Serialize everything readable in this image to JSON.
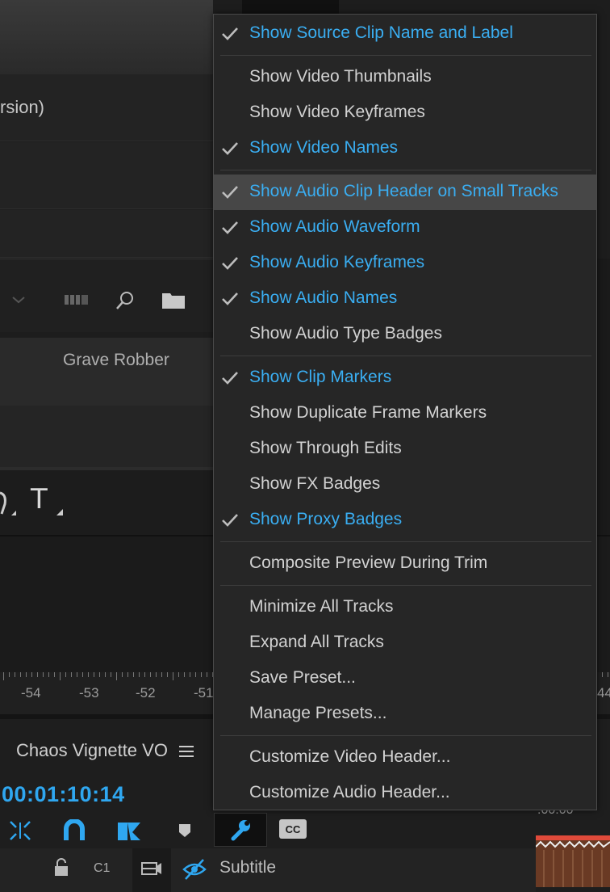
{
  "background": {
    "partial_label": "rsion)",
    "clip_name": "Grave Robber",
    "sequence_title": "Chaos Vignette VO",
    "timecode": "00:01:10:14",
    "ruler_numbers": [
      "-54",
      "-53",
      "-52",
      "-51",
      "44"
    ],
    "track_label": "C1",
    "subtitle_label": "Subtitle",
    "clip_time": ":00:00",
    "text_tool_glyph": "T"
  },
  "menu": {
    "items": [
      {
        "label": "Show Source Clip Name and Label",
        "checked": true
      },
      {
        "label": "Show Video Thumbnails",
        "checked": false
      },
      {
        "label": "Show Video Keyframes",
        "checked": false
      },
      {
        "label": "Show Video Names",
        "checked": true
      },
      {
        "label": "Show Audio Clip Header on Small Tracks",
        "checked": true,
        "highlighted": true
      },
      {
        "label": "Show Audio Waveform",
        "checked": true
      },
      {
        "label": "Show Audio Keyframes",
        "checked": true
      },
      {
        "label": "Show Audio Names",
        "checked": true
      },
      {
        "label": "Show Audio Type Badges",
        "checked": false
      },
      {
        "label": "Show Clip Markers",
        "checked": true
      },
      {
        "label": "Show Duplicate Frame Markers",
        "checked": false
      },
      {
        "label": "Show Through Edits",
        "checked": false
      },
      {
        "label": "Show FX Badges",
        "checked": false
      },
      {
        "label": "Show Proxy Badges",
        "checked": true
      },
      {
        "label": "Composite Preview During Trim",
        "checked": false
      },
      {
        "label": "Minimize All Tracks",
        "checked": false
      },
      {
        "label": "Expand All Tracks",
        "checked": false
      },
      {
        "label": "Save Preset...",
        "checked": false
      },
      {
        "label": "Manage Presets...",
        "checked": false
      },
      {
        "label": "Customize Video Header...",
        "checked": false
      },
      {
        "label": "Customize Audio Header...",
        "checked": false
      }
    ]
  },
  "colors": {
    "accent": "#3aaef2",
    "menu_bg": "#262626",
    "highlight": "#474747",
    "timecode": "#2fa7f0"
  }
}
